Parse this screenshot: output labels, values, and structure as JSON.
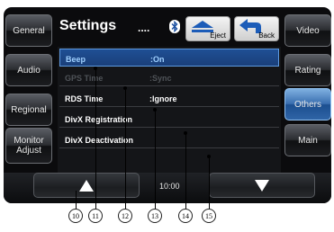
{
  "sidebar_left": [
    {
      "label": "General"
    },
    {
      "label": "Audio"
    },
    {
      "label": "Regional"
    },
    {
      "label": "Monitor\nAdjust"
    }
  ],
  "sidebar_right": [
    {
      "label": "Video",
      "active": false
    },
    {
      "label": "Rating",
      "active": false
    },
    {
      "label": "Others",
      "active": true
    },
    {
      "label": "Main",
      "active": false
    }
  ],
  "header": {
    "title": "Settings",
    "dots": "....",
    "eject_label": "Eject",
    "back_label": "Back"
  },
  "settings_list": [
    {
      "label": "Beep",
      "value": ":On",
      "state": "selected"
    },
    {
      "label": "GPS Time",
      "value": ":Sync",
      "state": "disabled"
    },
    {
      "label": "RDS Time",
      "value": ":Ignore",
      "state": "normal"
    },
    {
      "label": "DivX Registration",
      "value": "",
      "state": "normal"
    },
    {
      "label": "DivX Deactivation",
      "value": "",
      "state": "normal"
    }
  ],
  "status": {
    "clock": "10:00"
  },
  "callouts": [
    "10",
    "11",
    "12",
    "13",
    "14",
    "15"
  ],
  "colors": {
    "accent": "#2f64a6",
    "selected_text": "#9fd0ff",
    "screen_bg": "#0b0b0d"
  }
}
